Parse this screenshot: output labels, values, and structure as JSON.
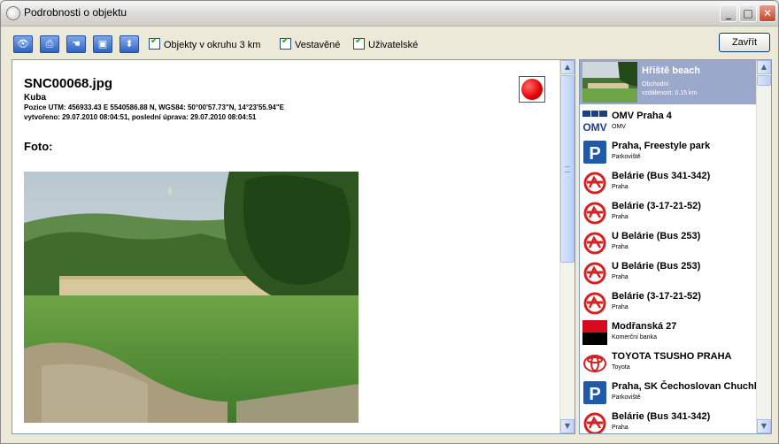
{
  "window": {
    "title": "Podrobnosti o objektu"
  },
  "toolbar": {
    "check_radius": "Objekty v okruhu 3 km",
    "check_builtin": "Vestavěné",
    "check_user": "Uživatelské",
    "close_label": "Zavřít"
  },
  "detail": {
    "title": "SNC00068.jpg",
    "subtitle": "Kuba",
    "position": "Pozice UTM: 456933.43 E 5540586.88 N, WGS84: 50°00'57.73\"N, 14°23'55.94\"E",
    "dates": "vytvořeno: 29.07.2010 08:04:51, poslední úprava: 29.07.2010 08:04:51",
    "foto_label": "Foto:"
  },
  "list": {
    "selected": {
      "name": "Hřiště beach",
      "category": "Obchodní",
      "distance": "vzdálenost: 0.15 km"
    },
    "items": [
      {
        "name": "OMV Praha 4",
        "category": "OMV",
        "icon": "omv-icon"
      },
      {
        "name": "Praha, Freestyle park",
        "category": "Parkoviště",
        "icon": "parking-icon"
      },
      {
        "name": "Belárie (Bus 341-342)",
        "category": "Praha",
        "icon": "transit-icon"
      },
      {
        "name": "Belárie (3-17-21-52)",
        "category": "Praha",
        "icon": "transit-icon"
      },
      {
        "name": "U Belárie (Bus 253)",
        "category": "Praha",
        "icon": "transit-icon"
      },
      {
        "name": "U Belárie (Bus 253)",
        "category": "Praha",
        "icon": "transit-icon"
      },
      {
        "name": "Belárie (3-17-21-52)",
        "category": "Praha",
        "icon": "transit-icon"
      },
      {
        "name": "Modřanská 27",
        "category": "Komerční banka",
        "icon": "bank-icon"
      },
      {
        "name": "TOYOTA TSUSHO PRAHA",
        "category": "Toyota",
        "icon": "toyota-icon"
      },
      {
        "name": "Praha, SK Čechoslovan Chuchle",
        "category": "Parkoviště",
        "icon": "parking-icon"
      },
      {
        "name": "Belárie (Bus 341-342)",
        "category": "Praha",
        "icon": "transit-icon"
      }
    ]
  },
  "omv_logo_text": "OMV",
  "parking_letter": "P"
}
